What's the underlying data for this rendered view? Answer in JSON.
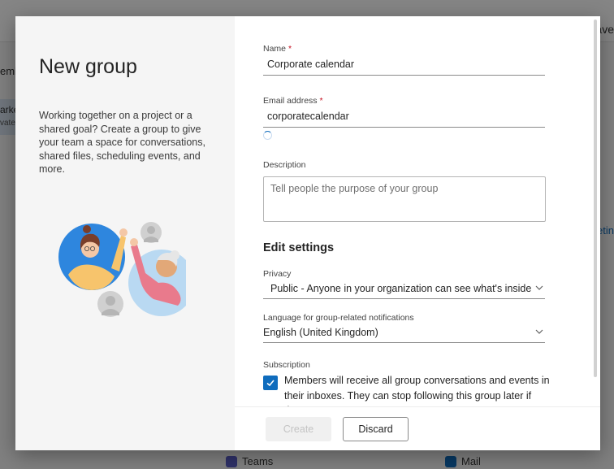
{
  "background": {
    "topbar_right_text": "ave",
    "side_label": "emb",
    "side_item_line1": "arke",
    "side_item_line2": "vate",
    "right_link": "etin",
    "apps": [
      {
        "label": "Teams",
        "icon": "teams-icon",
        "color": "#5b5fc7"
      },
      {
        "label": "Mail",
        "icon": "outlook-icon",
        "color": "#0f6cbd"
      }
    ]
  },
  "dialog": {
    "title": "New group",
    "intro": "Working together on a project or a shared goal? Create a group to give your team a space for conversations, shared files, scheduling events, and more.",
    "fields": {
      "name": {
        "label": "Name",
        "required_mark": "*",
        "value": "Corporate calendar"
      },
      "email": {
        "label": "Email address",
        "required_mark": "*",
        "value": "corporatecalendar"
      },
      "description": {
        "label": "Description",
        "placeholder": "Tell people the purpose of your group"
      }
    },
    "settings": {
      "title": "Edit settings",
      "privacy": {
        "label": "Privacy",
        "value": "Public - Anyone in your organization can see what's inside"
      },
      "language": {
        "label": "Language for group-related notifications",
        "value": "English (United Kingdom)"
      },
      "subscription": {
        "label": "Subscription",
        "checked": true,
        "text": "Members will receive all group conversations and events in their inboxes. They can stop following this group later if they"
      }
    },
    "buttons": {
      "create": "Create",
      "discard": "Discard"
    },
    "colors": {
      "accent": "#0f6cbd",
      "required": "#c50f1f"
    }
  }
}
